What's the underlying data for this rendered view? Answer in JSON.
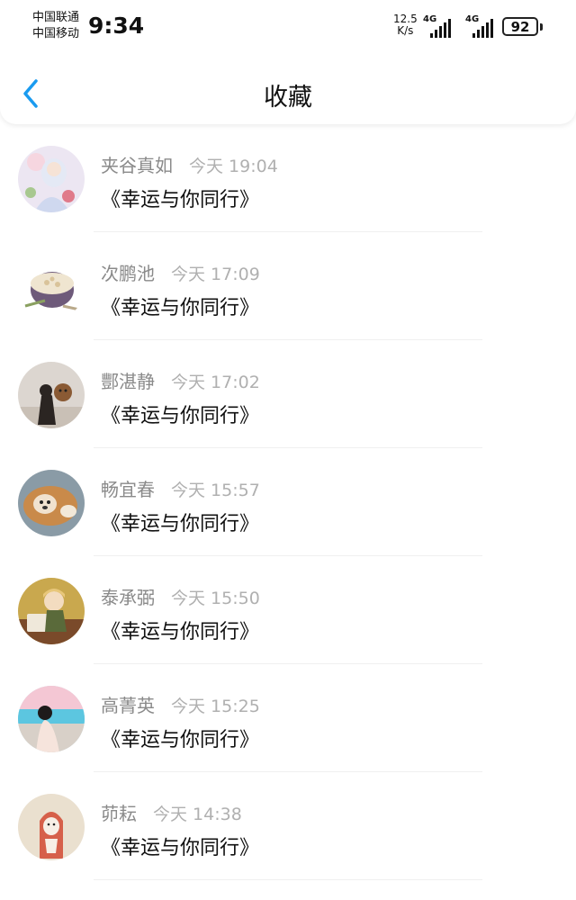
{
  "status_bar": {
    "carrier_1": "中国联通",
    "carrier_2": "中国移动",
    "time": "9:34",
    "speed_value": "12.5",
    "speed_unit": "K/s",
    "signal_1_label": "4G",
    "signal_2_label": "4G",
    "battery": "92"
  },
  "nav": {
    "back_icon": "chevron-left-icon",
    "title": "收藏",
    "accent_color": "#1a9bf0"
  },
  "favorites": [
    {
      "name": "夹谷真如",
      "time": "今天 19:04",
      "title": "《幸运与你同行》"
    },
    {
      "name": "次鹏池",
      "time": "今天 17:09",
      "title": "《幸运与你同行》"
    },
    {
      "name": "酆湛静",
      "time": "今天 17:02",
      "title": "《幸运与你同行》"
    },
    {
      "name": "畅宜春",
      "time": "今天 15:57",
      "title": "《幸运与你同行》"
    },
    {
      "name": "泰承弼",
      "time": "今天 15:50",
      "title": "《幸运与你同行》"
    },
    {
      "name": "高菁英",
      "time": "今天 15:25",
      "title": "《幸运与你同行》"
    },
    {
      "name": "茆耘",
      "time": "今天 14:38",
      "title": "《幸运与你同行》"
    }
  ]
}
